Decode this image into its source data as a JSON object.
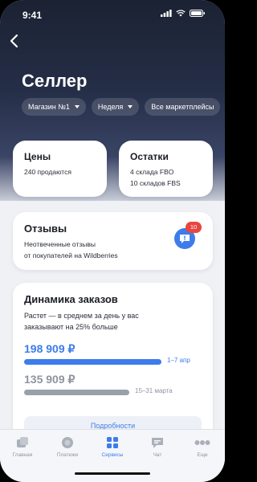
{
  "status": {
    "time": "9:41"
  },
  "page": {
    "title": "Селлер"
  },
  "filters": [
    {
      "label": "Магазин №1"
    },
    {
      "label": "Неделя"
    },
    {
      "label": "Все маркетплейсы"
    }
  ],
  "prices_card": {
    "title": "Цены",
    "line1": "240 продаются"
  },
  "stock_card": {
    "title": "Остатки",
    "line1": "4 склада FBO",
    "line2": "10 складов FBS"
  },
  "reviews_card": {
    "title": "Отзывы",
    "line1": "Неотвеченные отзывы",
    "line2": "от покупателей на Wildberries",
    "badge_count": "10"
  },
  "dynamics_card": {
    "title": "Динамика заказов",
    "line1": "Растет — в среднем за день у вас",
    "line2": "заказывают на 25% больше",
    "current": {
      "amount": "198 909 ₽",
      "period": "1–7 апр",
      "fill_fraction": 0.76,
      "color": "#3d7cea"
    },
    "previous": {
      "amount": "135 909 ₽",
      "period": "15–31 марта",
      "fill_fraction": 0.58,
      "color": "#9aa0aa"
    },
    "details_label": "Подробности"
  },
  "tabbar": {
    "items": [
      {
        "label": "Главная",
        "icon": "home-icon"
      },
      {
        "label": "Платежи",
        "icon": "payments-icon"
      },
      {
        "label": "Сервисы",
        "icon": "services-icon",
        "active": true
      },
      {
        "label": "Чат",
        "icon": "chat-icon"
      },
      {
        "label": "Еще",
        "icon": "more-icon"
      }
    ]
  },
  "colors": {
    "accent": "#3d7cea",
    "badge": "#e8463e"
  }
}
